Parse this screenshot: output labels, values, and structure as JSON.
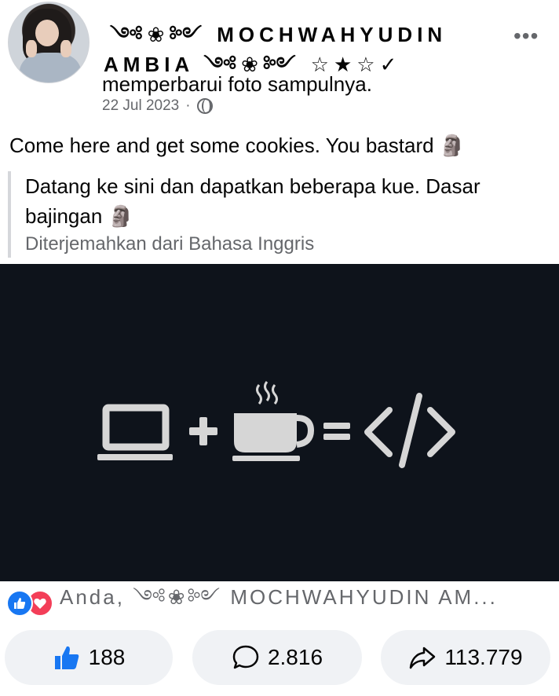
{
  "post": {
    "author_line1": "༺❀༻ MOCHWAHYUDIN",
    "author_line2": "AMBIA ༺❀༻ ☆★☆✓",
    "action": "memperbarui foto sampulnya.",
    "date": "22 Jul 2023",
    "separator": "·",
    "privacy_icon": "globe-icon",
    "more_label": "•••",
    "caption": "Come here and get some cookies. You bastard 🗿",
    "translation": "Datang ke sini dan dapatkan beberapa kue. Dasar bajingan 🗿",
    "translation_source": "Diterjemahkan dari Bahasa Inggris"
  },
  "reactions": {
    "icons": [
      "like-icon",
      "love-icon"
    ],
    "summary": "Anda, ༺❀༻ MOCHWAHYUDIN AM..."
  },
  "actions": {
    "like_count": "188",
    "comment_count": "2.816",
    "share_count": "113.779"
  },
  "colors": {
    "like_blue": "#1877f2",
    "love_red": "#f33e58",
    "image_bg": "#0e131b",
    "icon_gray": "#d6d6d6"
  }
}
